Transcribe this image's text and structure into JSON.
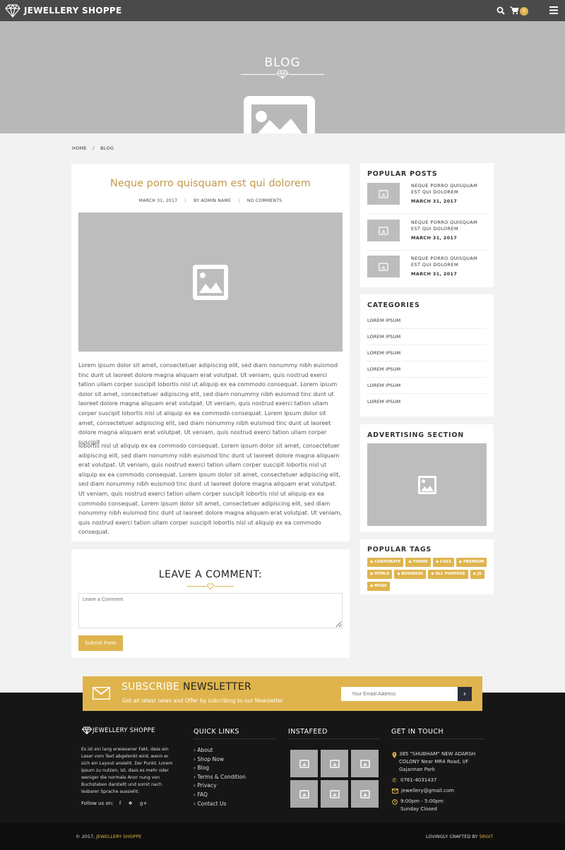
{
  "header": {
    "brand": "JEWELLERY SHOPPE",
    "cart_count": "0"
  },
  "hero": {
    "title": "BLOG"
  },
  "breadcrumb": {
    "home": "HOME",
    "sep": "/",
    "current": "BLOG"
  },
  "post": {
    "title": "Neque porro quisquam est qui dolorem",
    "date": "MARCH 31, 2017",
    "author": "BY ADMIN NAME",
    "comments": "NO COMMENTS",
    "sep": "|",
    "para1": "Lorem ipsum dolor sit amet, consectetuer adipiscing elit, sed diam nonummy nibh euismod tinc dunt ut laoreet dolore magna aliquam erat volutpat. Ut veniam, quis nostrud exerci tation ullam corper suscipit lobortis nisl ut aliquip ex ea commodo consequat. Lorem ipsum dolor sit amet, consectetuer adipiscing elit, sed diam nonummy nibh euismod tinc dunt ut laoreet dolore magna aliquam erat volutpat. Ut veniam, quis nostrud exerci tation ullam corper suscipit lobortis nisl ut aliquip ex ea commodo consequat. Lorem ipsum dolor sit amet, consectetuer adipiscing elit, sed diam nonummy nibh euismod tinc dunt ut laoreet dolore magna aliquam erat volutpat. Ut veniam, quis nostrud exerci tation ullam corper suscipit",
    "para2": "lobortis nisl ut aliquip ex ea commodo consequat. Lorem ipsum dolor sit amet, consectetuer adipiscing elit, sed diam nonummy nibh euismod tinc dunt ut laoreet dolore magna aliquam erat volutpat. Ut veniam, quis nostrud exerci tation ullam corper suscipit lobortis nisl ut aliquip ex ea commodo consequat. Lorem ipsum dolor sit amet, consectetuer adipiscing elit, sed diam nonummy nibh euismod tinc dunt ut laoreet dolore magna aliquam erat volutpat. Ut veniam, quis nostrud exerci tation ullam corper suscipit lobortis nisl ut aliquip ex ea commodo consequat. Lorem ipsum dolor sit amet, consectetuer adipiscing elit, sed diam nonummy nibh euismod tinc dunt ut laoreet dolore magna aliquam erat volutpat. Ut veniam, quis nostrud exerci tation ullam corper suscipit lobortis nisl ut aliquip ex ea commodo consequat."
  },
  "comment": {
    "heading": "LEAVE A COMMENT:",
    "placeholder": "Leave a Comment",
    "submit": "Submit Form"
  },
  "sidebar": {
    "popular_title": "POPULAR POSTS",
    "popular": [
      {
        "title": "NEQUE PORRO QUISQUAM EST QUI DOLOREM",
        "date": "MARCH 31, 2017"
      },
      {
        "title": "NEQUE PORRO QUISQUAM EST QUI DOLOREM",
        "date": "MARCH 31, 2017"
      },
      {
        "title": "NEQUE PORRO QUISQUAM EST QUI DOLOREM",
        "date": "MARCH 31, 2017"
      }
    ],
    "categories_title": "CATEGORIES",
    "categories": [
      "LOREM IPSUM",
      "LOREM IPSUM",
      "LOREM IPSUM",
      "LOREM IPSUM",
      "LOREM IPSUM",
      "LOREM IPSUM"
    ],
    "ad_title": "ADVERTISING SECTION",
    "tags_title": "POPULAR TAGS",
    "tags": [
      "CORPORATE",
      "THEME",
      "CSS3",
      "PREMIUM",
      "HTML5",
      "BUSINESS",
      "ALL PURPOSE",
      "JS",
      "MUSE"
    ]
  },
  "newsletter": {
    "title_a": "SUBSCRIBE",
    "title_b": "NEWSLETTER",
    "subtitle": "Get all latesr news and Offer by subcribing to our Newsletter",
    "placeholder": "Your Emaill Address"
  },
  "footer": {
    "brand": "JEWELLERY SHOPPE",
    "about": "Es ist ein lang erwiesener Fakt, dass ein Leser vom Text abgelenkt wird, wenn er sich ein Layout ansieht. Der Punkt, Lorem Ipsum zu nutzen, ist, dass es mehr oder weniger die normale Anor nung von Buchstaben darstellt und somit nach lesbarer Sprache aussieht.",
    "follow": "Follow us on:",
    "quick_title": "QUICK LINKS",
    "links": [
      "About",
      "Shop Now",
      "Blog",
      "Terms & Condition",
      "Privacy",
      "FAQ",
      "Contact Us"
    ],
    "insta_title": "INSTAFEED",
    "contact_title": "GET IN TOUCH",
    "address": "385 \"SHUBHAM\" NEW ADARSH COLONY Near MR4 Road, I/F Gajannan Park",
    "phone": "0761-4031437",
    "email": "jewellery@gmail.com",
    "hours": "9:00pm - 5:00pm",
    "closed": "Sunday Closed",
    "copyright_pre": "© 2017,",
    "copyright_brand": "JEWELLERY SHOPPE",
    "crafted_pre": "LOVINGLY CRAFTED BY",
    "crafted_brand": "SRGIT"
  },
  "colors": {
    "gold": "#dfb44d",
    "dark": "#161616",
    "nav": "#4a4a4a",
    "hero": "#b8b8b8",
    "title_gold": "#c09a4a"
  },
  "icons": [
    "diamond-icon",
    "search-icon",
    "cart-icon",
    "menu-icon",
    "image-placeholder-icon",
    "envelope-icon",
    "arrow-right-icon",
    "facebook-icon",
    "twitter-icon",
    "google-plus-icon",
    "location-icon",
    "phone-icon",
    "mail-icon",
    "clock-icon",
    "tag-icon"
  ]
}
